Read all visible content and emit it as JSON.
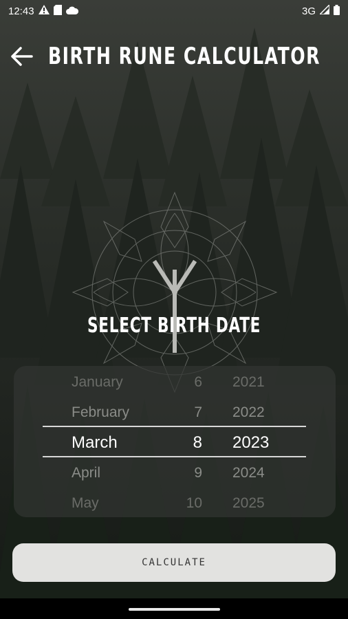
{
  "status_bar": {
    "time": "12:43",
    "network": "3G",
    "left_icons": [
      "alert-icon",
      "sd-card-icon",
      "cloud-icon"
    ],
    "right_icons": [
      "signal-icon",
      "battery-icon"
    ]
  },
  "app_bar": {
    "title": "Birth Rune Calculator",
    "back_icon": "arrow-left-icon"
  },
  "emblem": {
    "icon": "rune-algiz-mandala-icon"
  },
  "section_label": "Select Birth Date",
  "date_picker": {
    "rows": [
      {
        "month": "January",
        "day": "6",
        "year": "2021"
      },
      {
        "month": "February",
        "day": "7",
        "year": "2022"
      },
      {
        "month": "March",
        "day": "8",
        "year": "2023"
      },
      {
        "month": "April",
        "day": "9",
        "year": "2024"
      },
      {
        "month": "May",
        "day": "10",
        "year": "2025"
      }
    ],
    "selected": {
      "month": "March",
      "day": "8",
      "year": "2023"
    }
  },
  "calculate_button": {
    "label": "Calculate"
  },
  "colors": {
    "background": "#1b1f1b",
    "button": "#e2e2e0",
    "text": "#ffffff",
    "muted": "#8a8c88"
  }
}
